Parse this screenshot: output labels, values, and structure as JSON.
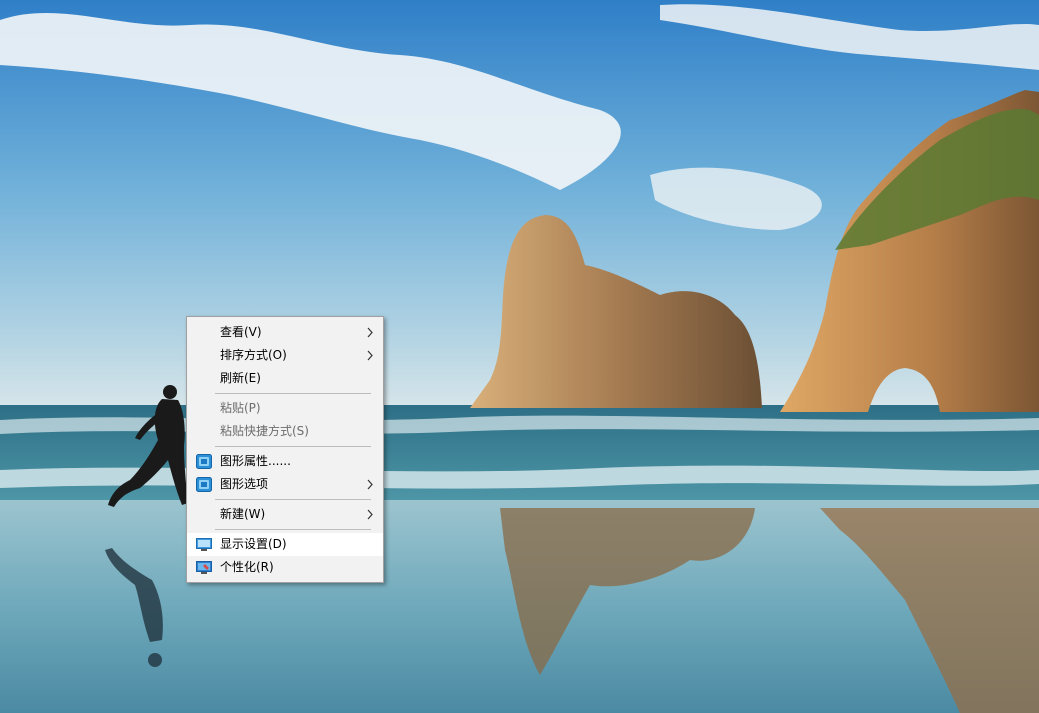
{
  "desktop": {
    "wallpaper": "beach-rocks-wallpaper",
    "colors": {
      "sky_top": "#2f7fc8",
      "sky_horizon": "#c9dfe9",
      "sea": "#3a8a9a",
      "sand": "#7fb3c2",
      "rock": "#a9835a"
    }
  },
  "context_menu": {
    "view": "查看(V)",
    "sort_by": "排序方式(O)",
    "refresh": "刷新(E)",
    "paste": "粘贴(P)",
    "paste_shortcut": "粘贴快捷方式(S)",
    "graphics_properties": "图形属性......",
    "graphics_options": "图形选项",
    "new": "新建(W)",
    "display_settings": "显示设置(D)",
    "personalize": "个性化(R)",
    "menu_colors": {
      "background": "#f2f2f2",
      "highlight": "#ffffff",
      "disabled_text": "#6d6d6d",
      "separator": "#bdbdbd"
    }
  }
}
